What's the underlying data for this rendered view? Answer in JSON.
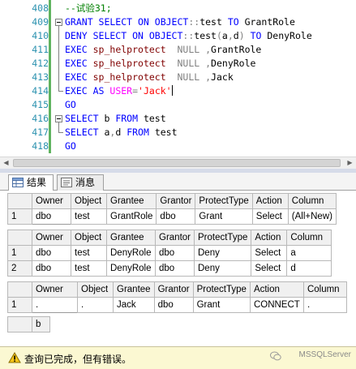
{
  "editor": {
    "lines": [
      {
        "num": "408",
        "segments": [
          {
            "t": "--试验31;",
            "c": "cm"
          }
        ]
      },
      {
        "num": "409",
        "segments": [
          {
            "t": "GRANT SELECT ON OBJECT",
            "c": "kw"
          },
          {
            "t": "::",
            "c": "gy"
          },
          {
            "t": "test ",
            "c": ""
          },
          {
            "t": "TO",
            "c": "kw"
          },
          {
            "t": " GrantRole",
            "c": ""
          }
        ]
      },
      {
        "num": "410",
        "segments": [
          {
            "t": "DENY SELECT ON OBJECT",
            "c": "kw"
          },
          {
            "t": "::",
            "c": "gy"
          },
          {
            "t": "test",
            "c": ""
          },
          {
            "t": "(",
            "c": "gy"
          },
          {
            "t": "a",
            "c": ""
          },
          {
            "t": ",",
            "c": "gy"
          },
          {
            "t": "d",
            "c": ""
          },
          {
            "t": ")",
            "c": "gy"
          },
          {
            "t": " TO",
            "c": "kw"
          },
          {
            "t": " DenyRole",
            "c": ""
          }
        ]
      },
      {
        "num": "411",
        "segments": [
          {
            "t": "EXEC",
            "c": "kw"
          },
          {
            "t": " sp_helprotect  ",
            "c": "fn"
          },
          {
            "t": "NULL",
            "c": "gy"
          },
          {
            "t": " ,",
            "c": "gy"
          },
          {
            "t": "GrantRole",
            "c": ""
          }
        ]
      },
      {
        "num": "412",
        "segments": [
          {
            "t": "EXEC",
            "c": "kw"
          },
          {
            "t": " sp_helprotect  ",
            "c": "fn"
          },
          {
            "t": "NULL",
            "c": "gy"
          },
          {
            "t": " ,",
            "c": "gy"
          },
          {
            "t": "DenyRole",
            "c": ""
          }
        ]
      },
      {
        "num": "413",
        "segments": [
          {
            "t": "EXEC",
            "c": "kw"
          },
          {
            "t": " sp_helprotect  ",
            "c": "fn"
          },
          {
            "t": "NULL",
            "c": "gy"
          },
          {
            "t": " ,",
            "c": "gy"
          },
          {
            "t": "Jack",
            "c": ""
          }
        ]
      },
      {
        "num": "414",
        "segments": [
          {
            "t": "EXEC AS",
            "c": "kw"
          },
          {
            "t": " ",
            "c": ""
          },
          {
            "t": "USER",
            "c": "pink"
          },
          {
            "t": "=",
            "c": "gy"
          },
          {
            "t": "'Jack'",
            "c": "st"
          }
        ]
      },
      {
        "num": "415",
        "segments": [
          {
            "t": "GO",
            "c": "kw"
          }
        ]
      },
      {
        "num": "416",
        "segments": [
          {
            "t": "SELECT",
            "c": "kw"
          },
          {
            "t": " b ",
            "c": ""
          },
          {
            "t": "FROM",
            "c": "kw"
          },
          {
            "t": " test",
            "c": ""
          }
        ]
      },
      {
        "num": "417",
        "segments": [
          {
            "t": "SELECT",
            "c": "kw"
          },
          {
            "t": " a",
            "c": ""
          },
          {
            "t": ",",
            "c": "gy"
          },
          {
            "t": "d ",
            "c": ""
          },
          {
            "t": "FROM",
            "c": "kw"
          },
          {
            "t": " test",
            "c": ""
          }
        ]
      },
      {
        "num": "418",
        "segments": [
          {
            "t": "GO",
            "c": "kw"
          }
        ]
      }
    ]
  },
  "tabs": [
    {
      "label": "结果",
      "icon": "grid-icon",
      "active": true
    },
    {
      "label": "消息",
      "icon": "message-icon",
      "active": false
    }
  ],
  "grids": [
    {
      "columns": [
        "Owner",
        "Object",
        "Grantee",
        "Grantor",
        "ProtectType",
        "Action",
        "Column"
      ],
      "rows": [
        {
          "n": "1",
          "cells": [
            "dbo",
            "test",
            "GrantRole",
            "dbo",
            "Grant",
            "Select",
            "(All+New)"
          ]
        }
      ]
    },
    {
      "columns": [
        "Owner",
        "Object",
        "Grantee",
        "Grantor",
        "ProtectType",
        "Action",
        "Column"
      ],
      "rows": [
        {
          "n": "1",
          "cells": [
            "dbo",
            "test",
            "DenyRole",
            "dbo",
            "Deny",
            "Select",
            "a"
          ]
        },
        {
          "n": "2",
          "cells": [
            "dbo",
            "test",
            "DenyRole",
            "dbo",
            "Deny",
            "Select",
            "d"
          ]
        }
      ]
    },
    {
      "columns": [
        "Owner",
        "Object",
        "Grantee",
        "Grantor",
        "ProtectType",
        "Action",
        "Column"
      ],
      "rows": [
        {
          "n": "1",
          "cells": [
            ".",
            ".",
            "Jack",
            "dbo",
            "Grant",
            "CONNECT",
            "."
          ]
        }
      ]
    },
    {
      "columns": [
        "b"
      ],
      "rows": []
    }
  ],
  "status": {
    "text": "查询已完成，但有错误。",
    "icon": "warning-icon",
    "watermark": "MSSQLServer"
  },
  "colors": {
    "keyword": "#0000ff",
    "comment": "#008000",
    "string": "#ff0000",
    "line_number": "#2b91af",
    "status_bg": "#fbf8d2"
  }
}
